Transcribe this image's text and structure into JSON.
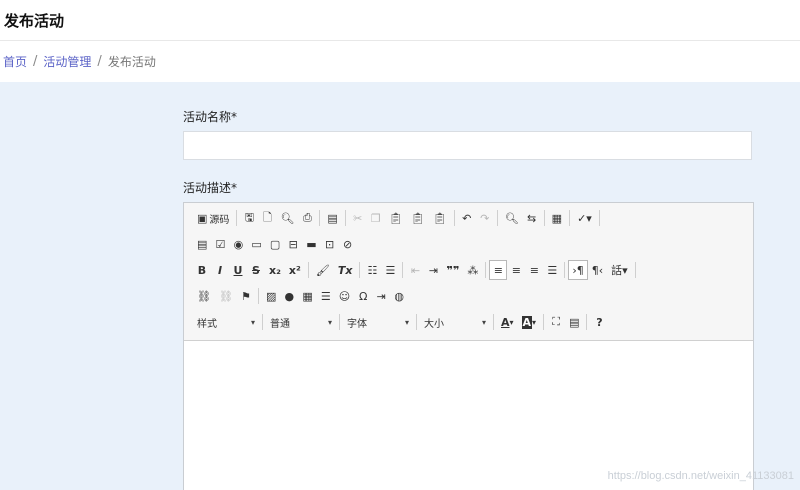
{
  "header": {
    "title": "发布活动"
  },
  "breadcrumb": {
    "home": "首页",
    "section": "活动管理",
    "current": "发布活动",
    "separator": "/"
  },
  "form": {
    "name_label": "活动名称",
    "name_required": "*",
    "name_value": "",
    "desc_label": "活动描述",
    "desc_required": "*"
  },
  "toolbar": {
    "row1": {
      "source_label": "源码"
    },
    "row3": {
      "bold": "B",
      "italic": "I",
      "underline": "U",
      "strike": "S",
      "subscript": "x₂",
      "superscript": "x²",
      "remove_format": "Tx",
      "blockquote": "❞❞",
      "hidden_format": "ꞏ¶"
    },
    "row5": {
      "styles_label": "样式",
      "format_label": "普通",
      "font_label": "字体",
      "size_label": "大小",
      "text_color": "A",
      "bg_color": "A",
      "help": "?"
    }
  },
  "watermark": "https://blog.csdn.net/weixin_41133081"
}
